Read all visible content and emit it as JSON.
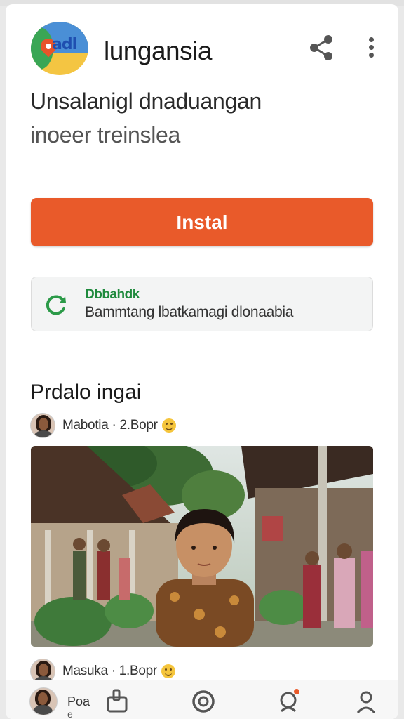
{
  "app": {
    "title": "lungansia",
    "logo_text": "adl",
    "subtitle_line1": "Unsalanigl dnaduangan",
    "subtitle_line2": "inoeer treinslea"
  },
  "actions": {
    "install_label": "Instal"
  },
  "info": {
    "title": "Dbbahdk",
    "text": "Bammtang lbatkamagi dlonaabia"
  },
  "section": {
    "title": "Prdalo ingai",
    "posts": [
      {
        "meta": "Mabotia · 2.Bopr"
      },
      {
        "meta": "Masuka · 1.Bopr"
      }
    ]
  },
  "bottom_nav": {
    "label": "Poa",
    "label_sub": "e"
  },
  "colors": {
    "accent": "#e95a2a",
    "success": "#1f8a3d"
  },
  "icons": [
    "share-icon",
    "more-vertical-icon",
    "refresh-icon",
    "emoji-icon",
    "home-icon",
    "discover-icon",
    "notifications-icon",
    "profile-icon"
  ]
}
